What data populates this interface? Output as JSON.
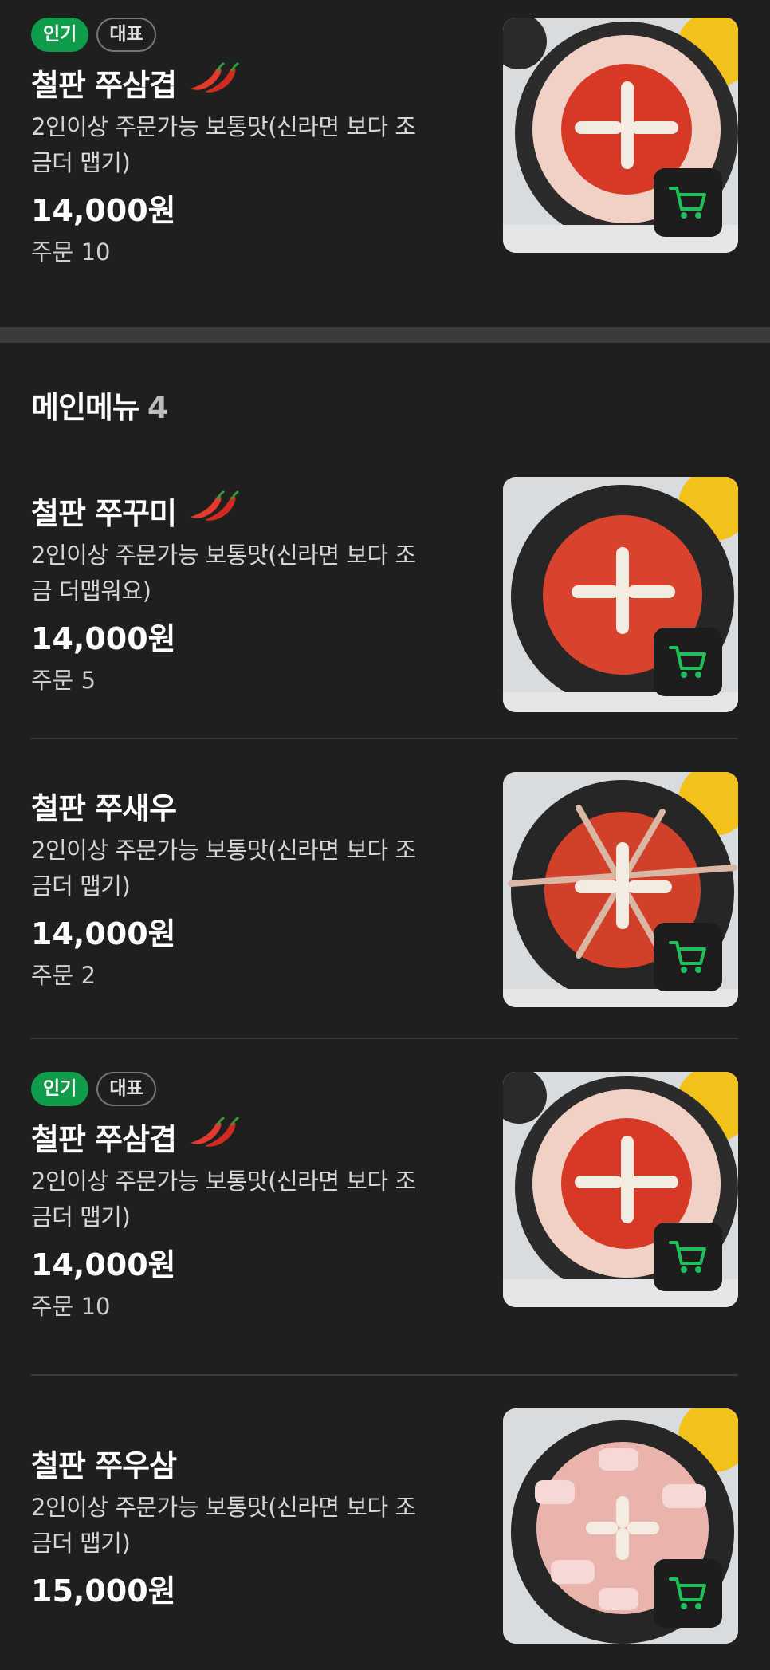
{
  "section": {
    "title": "메인메뉴",
    "count": "4"
  },
  "items": [
    {
      "badges": {
        "popular": "인기",
        "signature": "대표"
      },
      "name": "철판 쭈삼겹",
      "desc_line1": "2인이상 주문가능 보통맛(신라면 보다 조",
      "desc_line2": "금더 맵기)",
      "price": "14,000원",
      "orders": "주문 10",
      "spicy": true
    },
    {
      "name": "철판 쭈꾸미",
      "desc_line1": "2인이상 주문가능 보통맛(신라면 보다 조",
      "desc_line2": "금 더맵워요)",
      "price": "14,000원",
      "orders": "주문 5",
      "spicy": true
    },
    {
      "name": "철판 쭈새우",
      "desc_line1": "2인이상 주문가능 보통맛(신라면 보다 조",
      "desc_line2": "금더 맵기)",
      "price": "14,000원",
      "orders": "주문 2",
      "spicy": false
    },
    {
      "badges": {
        "popular": "인기",
        "signature": "대표"
      },
      "name": "철판 쭈삼겹",
      "desc_line1": "2인이상 주문가능 보통맛(신라면 보다 조",
      "desc_line2": "금더 맵기)",
      "price": "14,000원",
      "orders": "주문 10",
      "spicy": true
    },
    {
      "name": "철판 쭈우삼",
      "desc_line1": "2인이상 주문가능 보통맛(신라면 보다 조",
      "desc_line2": "금더 맵기)",
      "price": "15,000원",
      "spicy": false
    }
  ],
  "colors": {
    "accent_green": "#0f9d4a",
    "cart_icon": "#1fbf5c",
    "background": "#1f1f1f"
  }
}
